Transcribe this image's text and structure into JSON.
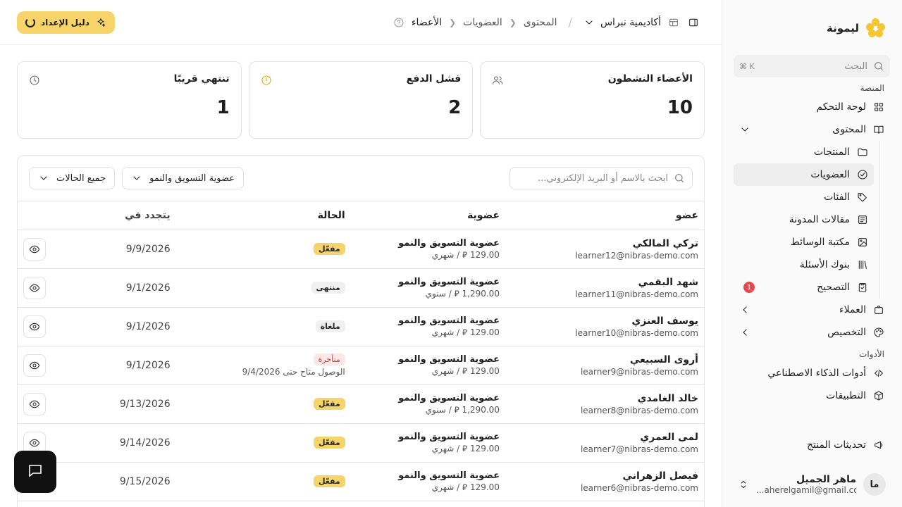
{
  "brand": {
    "name": "ليمونة",
    "logo_color": "#f5c631"
  },
  "search": {
    "placeholder": "البحث",
    "shortcut": "⌘ K"
  },
  "nav": {
    "platform_label": "المنصة",
    "dashboard": "لوحة التحكم",
    "content": "المحتوى",
    "sub": {
      "products": "المنتجات",
      "memberships": "العضويات",
      "categories": "الفئات",
      "blog": "مقالات المدونة",
      "media": "مكتبة الوسائط",
      "question_banks": "بنوك الأسئلة",
      "grading": "التصحيح",
      "grading_badge": "1"
    },
    "customers": "العملاء",
    "customization": "التخصيص",
    "tools_label": "الأدوات",
    "ai_tools": "أدوات الذكاء الاصطناعي",
    "apps": "التطبيقات",
    "product_updates": "تحديثات المنتج"
  },
  "user": {
    "initials": "ما",
    "name": "ماهر الجميل",
    "email": "...aherelgamil@gmail.com"
  },
  "topbar": {
    "org": "أكاديمية نبراس",
    "crumbs": [
      "المحتوى",
      "العضويات",
      "الأعضاء"
    ],
    "guide_button": "دليل الإعداد",
    "accent": "#f6d46a"
  },
  "stats": [
    {
      "title": "الأعضاء النشطون",
      "value": "10",
      "icon": "users-icon"
    },
    {
      "title": "فشل الدفع",
      "value": "2",
      "icon": "alert-icon"
    },
    {
      "title": "تنتهي قريبًا",
      "value": "1",
      "icon": "clock-icon"
    }
  ],
  "table": {
    "search_placeholder": "ابحث بالاسم أو البريد الإلكتروني...",
    "filter_plan": "عضوية التسويق والنمو",
    "filter_status": "جميع الحالات",
    "headers": {
      "member": "عضو",
      "plan": "عضوية",
      "status": "الحالة",
      "renews": "يتجدد في"
    },
    "rows": [
      {
        "name": "تركي المالكي",
        "email": "learner12@nibras-demo.com",
        "plan": "عضوية التسويق والنمو",
        "price": "129.00 ⃁ / شهري",
        "status": "مفعّل",
        "status_type": "active",
        "note": "",
        "renews": "9/9/2026"
      },
      {
        "name": "شهد البقمي",
        "email": "learner11@nibras-demo.com",
        "plan": "عضوية التسويق والنمو",
        "price": "1,290.00 ⃁ / سنوي",
        "status": "منتهى",
        "status_type": "neutral",
        "note": "",
        "renews": "9/1/2026"
      },
      {
        "name": "يوسف العنزي",
        "email": "learner10@nibras-demo.com",
        "plan": "عضوية التسويق والنمو",
        "price": "129.00 ⃁ / شهري",
        "status": "ملغاة",
        "status_type": "neutral",
        "note": "",
        "renews": "9/1/2026"
      },
      {
        "name": "أروى السبيعي",
        "email": "learner9@nibras-demo.com",
        "plan": "عضوية التسويق والنمو",
        "price": "129.00 ⃁ / شهري",
        "status": "متأخرة",
        "status_type": "late",
        "note": "الوصول متاح حتى 9/4/2026",
        "renews": "9/1/2026"
      },
      {
        "name": "خالد الغامدي",
        "email": "learner8@nibras-demo.com",
        "plan": "عضوية التسويق والنمو",
        "price": "1,290.00 ⃁ / سنوي",
        "status": "مفعّل",
        "status_type": "active",
        "note": "",
        "renews": "9/13/2026"
      },
      {
        "name": "لمى العمري",
        "email": "learner7@nibras-demo.com",
        "plan": "عضوية التسويق والنمو",
        "price": "129.00 ⃁ / شهري",
        "status": "مفعّل",
        "status_type": "active",
        "note": "",
        "renews": "9/14/2026"
      },
      {
        "name": "فيصل الزهراني",
        "email": "learner6@nibras-demo.com",
        "plan": "عضوية التسويق والنمو",
        "price": "129.00 ⃁ / شهري",
        "status": "مفعّل",
        "status_type": "active",
        "note": "",
        "renews": "9/15/2026"
      }
    ]
  }
}
